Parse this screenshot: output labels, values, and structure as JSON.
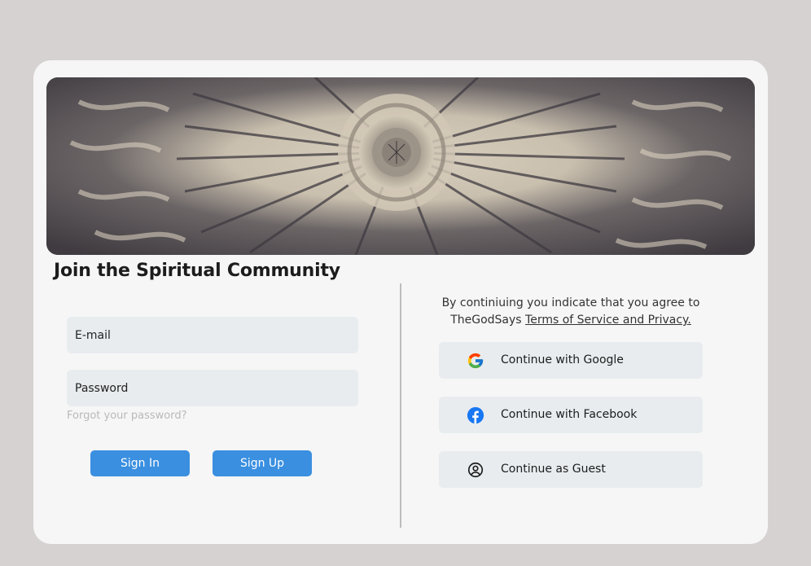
{
  "page": {
    "title": "Join the Spiritual Community"
  },
  "signin_form": {
    "email_placeholder": "E-mail",
    "password_placeholder": "Password",
    "forgot_label": "Forgot your password?",
    "sign_in_label": "Sign In",
    "sign_up_label": "Sign Up"
  },
  "consent": {
    "text": "By continiuing you indicate that you agree to TheGodSays ",
    "link": "Terms of Service and Privacy."
  },
  "social": {
    "google_label": "Continue with Google",
    "facebook_label": "Continue with Facebook",
    "guest_label": "Continue as Guest"
  },
  "colors": {
    "page_background": "#d6d2d1",
    "card_background": "#f6f6f6",
    "field_background": "#e8ecef",
    "primary_button": "#3a8fe0",
    "facebook_blue": "#1877f2"
  },
  "icons": {
    "banner": "radial-flower-artwork",
    "google": "google-g-icon",
    "facebook": "facebook-f-icon",
    "guest": "user-circle-icon"
  }
}
